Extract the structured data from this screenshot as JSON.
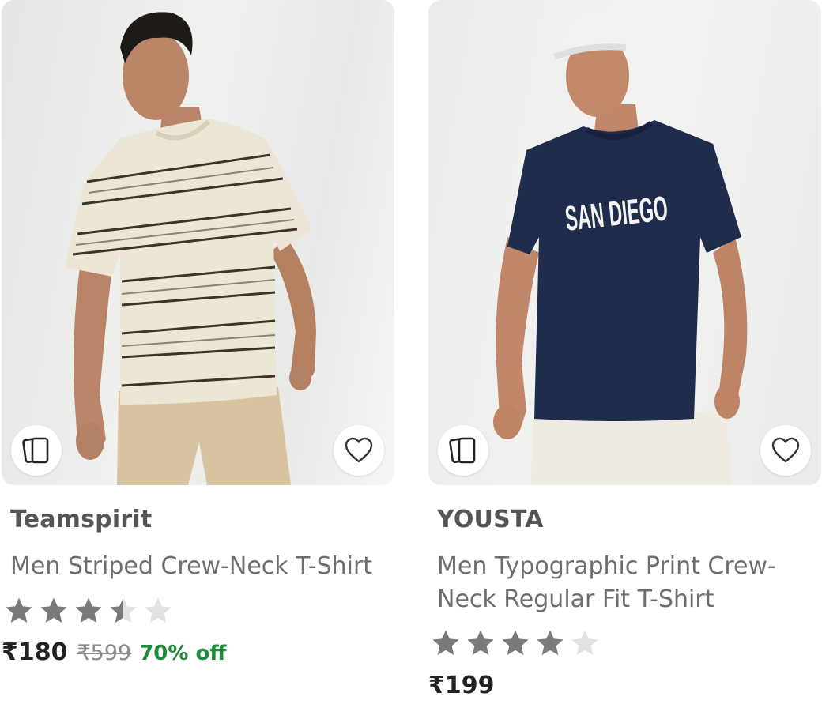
{
  "products": [
    {
      "brand": "Teamspirit",
      "title": "Men Striped Crew-Neck T-Shirt",
      "rating": 3.5,
      "rating_max": 5,
      "price": "₹180",
      "mrp": "₹599",
      "discount": "70% off",
      "image_alt": "Man wearing cream striped crew-neck t-shirt",
      "icons": {
        "similar": "similar-products-icon",
        "wishlist": "heart-icon"
      }
    },
    {
      "brand": "YOUSTA",
      "title": "Men Typographic Print Crew-Neck Regular Fit T-Shirt",
      "rating": 4,
      "rating_max": 5,
      "price": "₹199",
      "image_alt": "Man wearing navy SAN DIEGO print t-shirt and white cap",
      "print_text": "SAN DIEGO",
      "icons": {
        "similar": "similar-products-icon",
        "wishlist": "heart-icon"
      }
    }
  ],
  "colors": {
    "star_filled": "#7a7a7a",
    "star_empty": "#e2e2e2",
    "discount": "#1f8a3a"
  }
}
